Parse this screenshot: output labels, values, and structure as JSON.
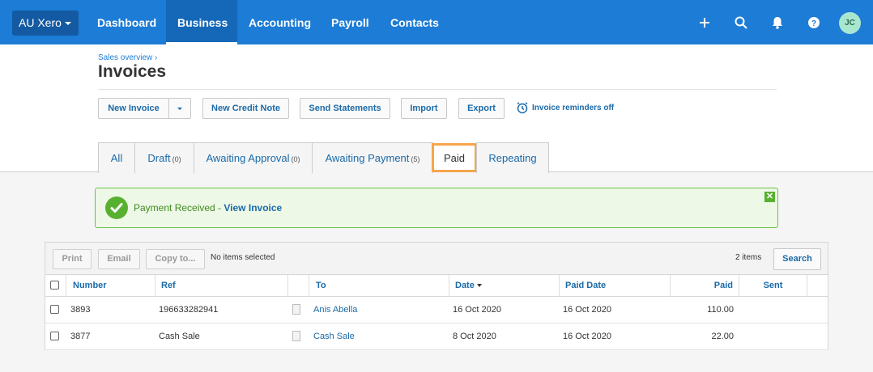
{
  "topnav": {
    "org": "AU Xero",
    "items": [
      "Dashboard",
      "Business",
      "Accounting",
      "Payroll",
      "Contacts"
    ],
    "active": "Business",
    "icons": [
      "plus-icon",
      "search-icon",
      "bell-icon",
      "help-icon"
    ],
    "avatar_initials": "JC",
    "color": "#1c7cd6"
  },
  "breadcrumb": "Sales overview ›",
  "title": "Invoices",
  "toolbar": {
    "new_invoice": "New Invoice",
    "new_credit_note": "New Credit Note",
    "send_statements": "Send Statements",
    "import": "Import",
    "export": "Export",
    "reminders": "Invoice reminders off"
  },
  "tabs": [
    {
      "label": "All",
      "count": ""
    },
    {
      "label": "Draft",
      "count": "(0)"
    },
    {
      "label": "Awaiting Approval",
      "count": "(0)"
    },
    {
      "label": "Awaiting Payment",
      "count": "(5)"
    },
    {
      "label": "Paid",
      "count": ""
    },
    {
      "label": "Repeating",
      "count": ""
    }
  ],
  "active_tab": "Paid",
  "alert": {
    "text": "Payment Received - ",
    "link": "View Invoice",
    "color": "#58b030"
  },
  "panel": {
    "print": "Print",
    "email": "Email",
    "copy_to": "Copy to...",
    "no_selection": "No items selected",
    "items_count": "2 items",
    "search": "Search"
  },
  "table": {
    "headers": {
      "number": "Number",
      "ref": "Ref",
      "to": "To",
      "date": "Date",
      "paid_date": "Paid Date",
      "paid": "Paid",
      "sent": "Sent"
    },
    "rows": [
      {
        "number": "3893",
        "ref": "196633282941",
        "to": "Anis Abella",
        "date": "16 Oct 2020",
        "paid_date": "16 Oct 2020",
        "paid": "110.00",
        "sent": ""
      },
      {
        "number": "3877",
        "ref": "Cash Sale",
        "to": "Cash Sale",
        "date": "8 Oct 2020",
        "paid_date": "16 Oct 2020",
        "paid": "22.00",
        "sent": ""
      }
    ]
  }
}
